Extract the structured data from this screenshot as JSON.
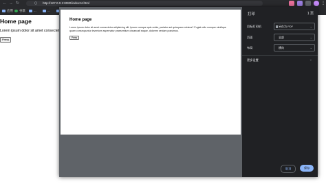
{
  "browser": {
    "url": "http://127.0.0.1:8080/index24.html",
    "bookmarks": [
      {
        "label": "应用"
      },
      {
        "label": "谷歌"
      },
      {
        "label": "..."
      },
      {
        "label": "..."
      },
      {
        "label": "..."
      },
      {
        "label": "...sk"
      },
      {
        "label": "..."
      },
      {
        "label": "...B"
      }
    ]
  },
  "page": {
    "heading": "Home page",
    "text": "Lorem ipsum dolor sit amet consectetur",
    "button": "Press"
  },
  "preview": {
    "heading": "Home page",
    "text": "Lorem ipsum dolor sit amet consectetur adipisicing elit. Ipsum cumque quis nobis, pariatur aut quisquam minima? Fugiat odio cumque similique quam consequuntur inventore aspernatur praesentium obcaecati eaque, dolorem veniam possimus.",
    "button": "Press"
  },
  "print": {
    "title": "打印",
    "pages_count": "1 页",
    "rows": [
      {
        "label": "目标打印机",
        "value": "另存为 PDF"
      },
      {
        "label": "页面",
        "value": "全部"
      },
      {
        "label": "布局",
        "value": "横向"
      }
    ],
    "more_settings": "更多设置",
    "cancel": "取消",
    "save": "保存"
  },
  "colors": {
    "accent": "#8ab4f8",
    "panel": "#202124",
    "toolbar": "#292a2d"
  }
}
